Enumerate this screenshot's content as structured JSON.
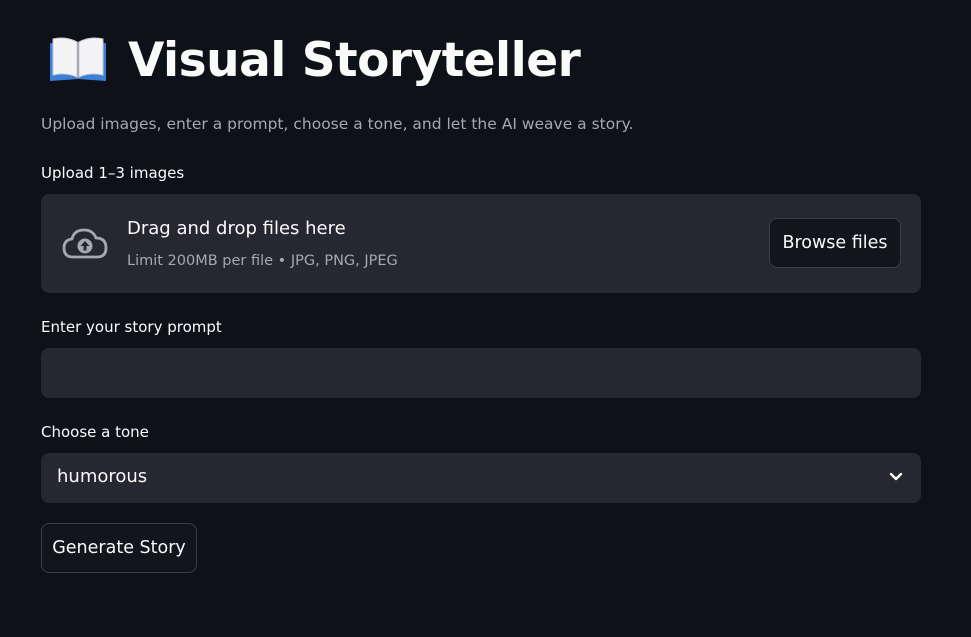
{
  "header": {
    "icon": "open-book-icon",
    "title": "Visual Storyteller",
    "subtitle": "Upload images, enter a prompt, choose a tone, and let the AI weave a story."
  },
  "uploader": {
    "label": "Upload 1–3 images",
    "icon": "cloud-upload-icon",
    "drop_text": "Drag and drop files here",
    "limit_text": "Limit 200MB per file • JPG, PNG, JPEG",
    "browse_label": "Browse files"
  },
  "prompt": {
    "label": "Enter your story prompt",
    "value": "",
    "placeholder": ""
  },
  "tone": {
    "label": "Choose a tone",
    "selected": "humorous",
    "icon": "chevron-down-icon"
  },
  "actions": {
    "generate_label": "Generate Story"
  },
  "colors": {
    "background": "#0e1117",
    "surface": "#262730",
    "text": "#fafafa",
    "muted_text": "#a3a8b4",
    "button_bg": "#13151c",
    "button_border": "#3b3d47"
  }
}
